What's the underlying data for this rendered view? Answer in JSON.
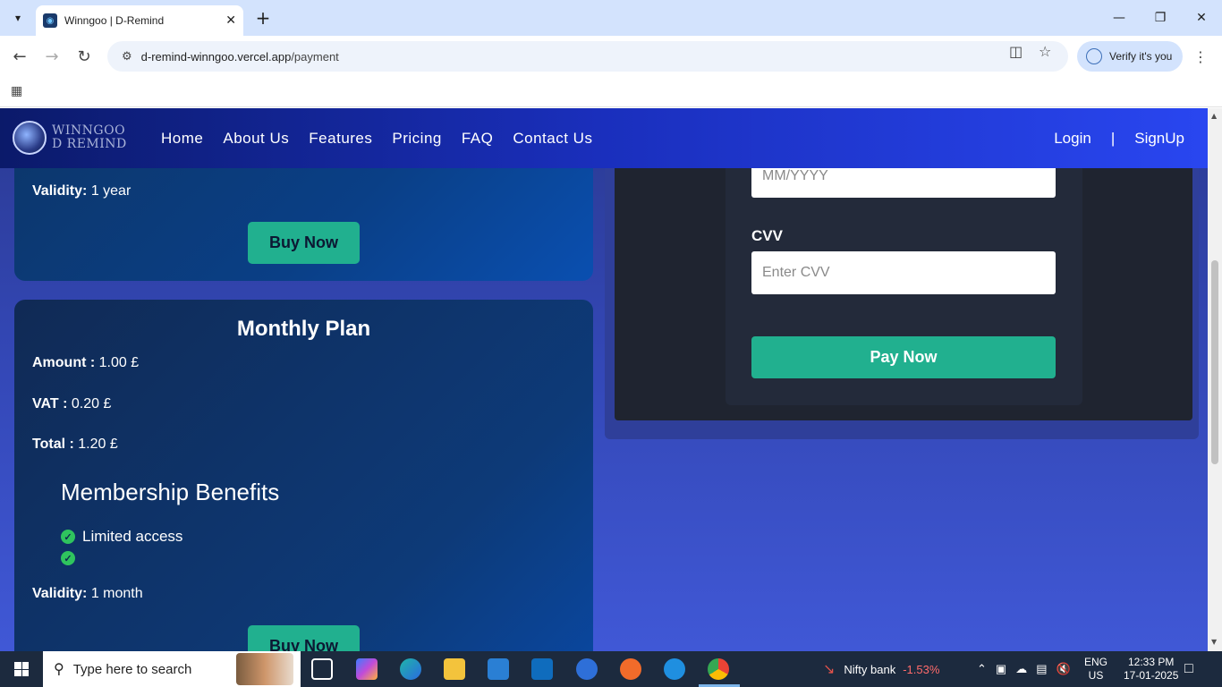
{
  "browser": {
    "tab_title": "Winngoo | D-Remind",
    "url_host": "d-remind-winngoo.vercel.app",
    "url_path": "/payment",
    "verify_label": "Verify it's you"
  },
  "site": {
    "logo_line1": "WINNGOO",
    "logo_line2": "D REMIND",
    "nav": [
      "Home",
      "About Us",
      "Features",
      "Pricing",
      "FAQ",
      "Contact Us"
    ],
    "login": "Login",
    "separator": "|",
    "signup": "SignUp"
  },
  "plans": {
    "yearly": {
      "validity_label": "Validity:",
      "validity_value": "1 year",
      "buy_label": "Buy Now"
    },
    "monthly": {
      "title": "Monthly Plan",
      "amount_label": "Amount :",
      "amount_value": "1.00 £",
      "vat_label": "VAT :",
      "vat_value": "0.20 £",
      "total_label": "Total :",
      "total_value": "1.20 £",
      "benefits_title": "Membership Benefits",
      "benefits": [
        "Limited access",
        ""
      ],
      "validity_label": "Validity:",
      "validity_value": "1 month",
      "buy_label": "Buy Now"
    }
  },
  "payment": {
    "expiry_placeholder": "MM/YYYY",
    "cvv_label": "CVV",
    "cvv_placeholder": "Enter CVV",
    "pay_label": "Pay Now"
  },
  "taskbar": {
    "search_placeholder": "Type here to search",
    "stock_name": "Nifty bank",
    "stock_change": "-1.53%",
    "lang_line1": "ENG",
    "lang_line2": "US",
    "time": "12:33 PM",
    "date": "17-01-2025"
  },
  "colors": {
    "accent_green": "#21b08f",
    "stock_negative": "#ff6b6b"
  }
}
